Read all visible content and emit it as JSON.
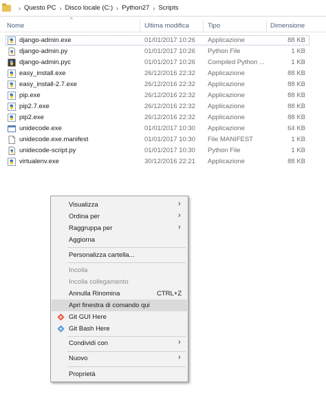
{
  "breadcrumb": [
    "Questo PC",
    "Disco locale (C:)",
    "Python27",
    "Scripts"
  ],
  "columns": {
    "name": "Nome",
    "date": "Ultima modifica",
    "type": "Tipo",
    "size": "Dimensione"
  },
  "files": [
    {
      "name": "django-admin.exe",
      "date": "01/01/2017 10:26",
      "type": "Applicazione",
      "size": "88 KB",
      "icon": "python-exe-icon"
    },
    {
      "name": "django-admin.py",
      "date": "01/01/2017 10:26",
      "type": "Python File",
      "size": "1 KB",
      "icon": "python-file-icon"
    },
    {
      "name": "django-admin.pyc",
      "date": "01/01/2017 10:26",
      "type": "Compiled Python ...",
      "size": "1 KB",
      "icon": "python-compiled-icon"
    },
    {
      "name": "easy_install.exe",
      "date": "26/12/2016 22:32",
      "type": "Applicazione",
      "size": "88 KB",
      "icon": "python-exe-icon"
    },
    {
      "name": "easy_install-2.7.exe",
      "date": "26/12/2016 22:32",
      "type": "Applicazione",
      "size": "88 KB",
      "icon": "python-exe-icon"
    },
    {
      "name": "pip.exe",
      "date": "26/12/2016 22:32",
      "type": "Applicazione",
      "size": "88 KB",
      "icon": "python-exe-icon"
    },
    {
      "name": "pip2.7.exe",
      "date": "26/12/2016 22:32",
      "type": "Applicazione",
      "size": "88 KB",
      "icon": "python-exe-icon"
    },
    {
      "name": "pip2.exe",
      "date": "26/12/2016 22:32",
      "type": "Applicazione",
      "size": "88 KB",
      "icon": "python-exe-icon"
    },
    {
      "name": "unidecode.exe",
      "date": "01/01/2017 10:30",
      "type": "Applicazione",
      "size": "64 KB",
      "icon": "window-exe-icon"
    },
    {
      "name": "unidecode.exe.manifest",
      "date": "01/01/2017 10:30",
      "type": "File MANIFEST",
      "size": "1 KB",
      "icon": "document-icon"
    },
    {
      "name": "unidecode-script.py",
      "date": "01/01/2017 10:30",
      "type": "Python File",
      "size": "1 KB",
      "icon": "python-file-icon"
    },
    {
      "name": "virtualenv.exe",
      "date": "30/12/2016 22:21",
      "type": "Applicazione",
      "size": "88 KB",
      "icon": "python-exe-icon"
    }
  ],
  "context_menu": {
    "visualizza": "Visualizza",
    "ordina_per": "Ordina per",
    "raggruppa_per": "Raggruppa per",
    "aggiorna": "Aggiorna",
    "personalizza": "Personalizza cartella...",
    "incolla": "Incolla",
    "incolla_collegamento": "Incolla collegamento",
    "annulla_rinomina": "Annulla Rinomina",
    "annulla_shortcut": "CTRL+Z",
    "apri_finestra": "Apri finestra di comando qui",
    "git_gui": "Git GUI Here",
    "git_bash": "Git Bash Here",
    "condividi": "Condividi con",
    "nuovo": "Nuovo",
    "proprieta": "Proprietà"
  },
  "colors": {
    "header_text": "#4c607a",
    "menu_bg": "#f2f2f2",
    "highlight": "#dadada",
    "folder": "#e8c25a"
  }
}
